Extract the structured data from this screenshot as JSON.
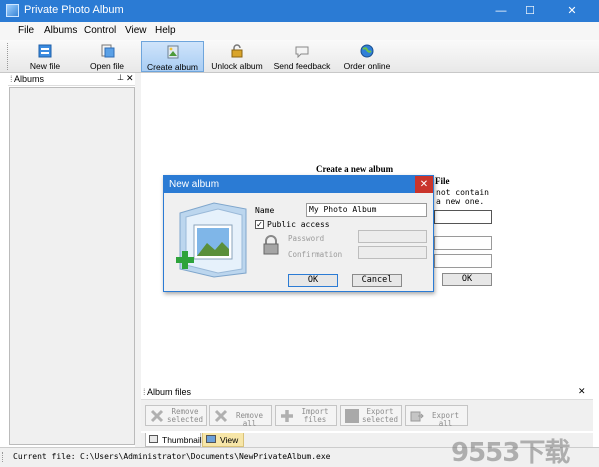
{
  "window": {
    "title": "Private Photo Album",
    "controls": {
      "minimize": "—",
      "maximize": "☐",
      "close": "✕"
    }
  },
  "menu": [
    "File",
    "Albums",
    "Control",
    "View",
    "Help"
  ],
  "toolbar": {
    "new_file": "New file",
    "open_file": "Open file",
    "create_album": "Create album",
    "unlock_album": "Unlock album",
    "send_feedback": "Send feedback",
    "order_online": "Order online"
  },
  "albums_panel": {
    "title": "Albums",
    "pin": "⊥",
    "close": "✕"
  },
  "background_form": {
    "heading": "Create a new album",
    "line1": "File",
    "line2": "not contain",
    "line3": "a new one.",
    "ok": "OK"
  },
  "dialog": {
    "title": "New album",
    "close": "✕",
    "name_label": "Name",
    "name_value": "My Photo Album",
    "public_access_label": "Public access",
    "public_access_checked": true,
    "password_label": "Password",
    "confirmation_label": "Confirmation",
    "ok": "OK",
    "cancel": "Cancel"
  },
  "album_files": {
    "title": "Album files",
    "close": "✕",
    "tools": {
      "remove_selected": "Remove selected",
      "remove_all": "Remove all",
      "import_files": "Import files",
      "export_selected": "Export selected",
      "export_all": "Export all"
    },
    "tabs": {
      "thumbnails": "Thumbnails",
      "view": "View"
    }
  },
  "status": {
    "label": "Current file:",
    "path": "C:\\Users\\Administrator\\Documents\\NewPrivateAlbum.exe"
  },
  "watermark": "9553下载"
}
